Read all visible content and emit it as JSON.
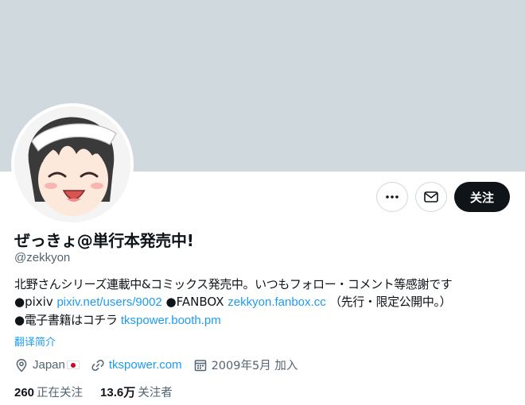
{
  "profile": {
    "display_name": "ぜっきょ@単行本発売中!",
    "handle": "@zekkyon",
    "bio": {
      "line1": "北野さんシリーズ連載中&コミックス発売中。いつもフォロー・コメント等感謝です",
      "pixiv_label": "●pixiv ",
      "pixiv_link": "pixiv.net/users/9002",
      "fanbox_label": " ●FANBOX ",
      "fanbox_link": "zekkyon.fanbox.cc",
      "fanbox_note": " （先行・限定公開中。）",
      "ebook_label": "●電子書籍はコチラ ",
      "ebook_link": "tkspower.booth.pm"
    },
    "translate_label": "翻译简介",
    "location": "Japan",
    "website": "tkspower.com",
    "joined": "2009年5月 加入",
    "following_count": "260",
    "following_label": "正在关注",
    "followers_count": "13.6万",
    "followers_label": "关注者"
  },
  "actions": {
    "follow_label": "关注",
    "more_icon": "more-icon",
    "message_icon": "mail-icon"
  },
  "colors": {
    "banner": "#cfd9de",
    "link": "#1d9bf0",
    "secondary_text": "#536471",
    "primary_text": "#0f1419"
  }
}
